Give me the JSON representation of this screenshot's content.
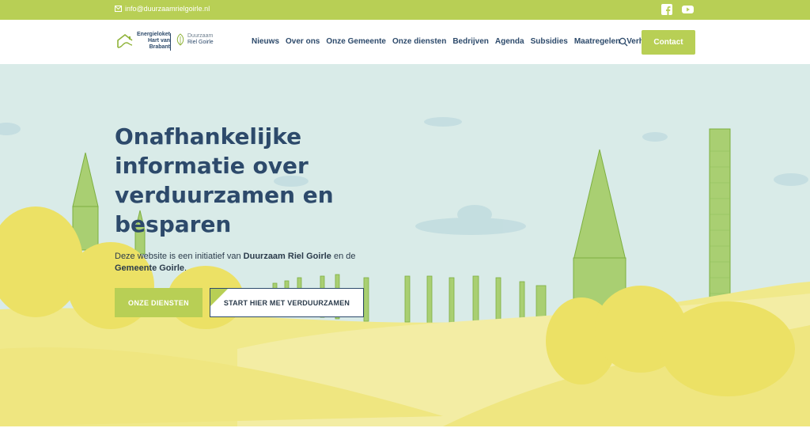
{
  "topbar": {
    "email": "info@duurzaamrielgoirle.nl",
    "icons": [
      "mail-icon",
      "facebook-icon",
      "youtube-icon"
    ],
    "color": "#b8cf55"
  },
  "header": {
    "logo1": {
      "line1": "Energieloket",
      "line2": "Hart van",
      "line3": "Brabant"
    },
    "logo2": {
      "line1": "Duurzaam",
      "line2": "Riel Goirle"
    },
    "nav": [
      "Nieuws",
      "Over ons",
      "Onze Gemeente",
      "Onze diensten",
      "Bedrijven",
      "Agenda",
      "Subsidies",
      "Maatregelen",
      "Verhalen"
    ],
    "contact_label": "Contact"
  },
  "hero": {
    "title": "Onafhankelijke informatie over verduurzamen en besparen",
    "sub_prefix": "Deze website is een initiatief van ",
    "sub_org1": "Duurzaam Riel Goirle",
    "sub_mid": " en de ",
    "sub_org2": "Gemeente Goirle",
    "sub_suffix": ".",
    "btn_primary": "ONZE DIENSTEN",
    "btn_secondary": "START HIER MET VERDUURZAMEN"
  },
  "colors": {
    "accent": "#b8cf55",
    "navy": "#2d4a6b",
    "sky": "#d9ebe8",
    "field": "#f0e98a"
  }
}
